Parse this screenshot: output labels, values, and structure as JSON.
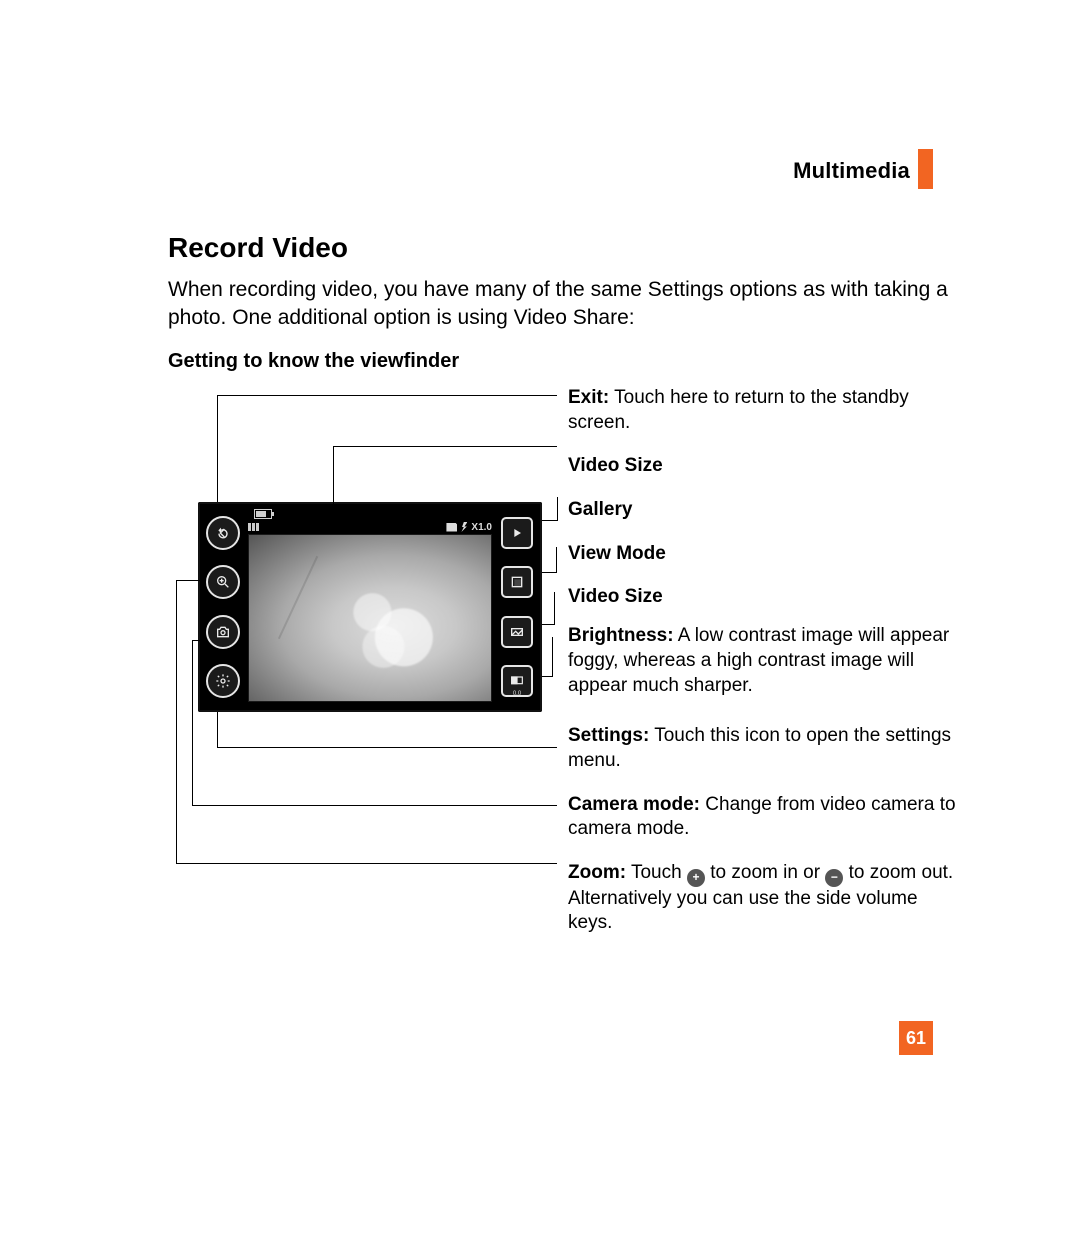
{
  "header": {
    "section": "Multimedia"
  },
  "title": "Record Video",
  "intro": "When recording video, you have many of the same Settings options as with taking a photo. One additional option is using Video Share:",
  "subtitle": "Getting to know the viewfinder",
  "viewfinder": {
    "zoom_label": "X1.0",
    "brightness_value": "0.0"
  },
  "callouts": {
    "exit": {
      "label": "Exit:",
      "text": " Touch here to return to the standby screen."
    },
    "video_size_top": "Video Size",
    "gallery": "Gallery",
    "view_mode": "View Mode",
    "video_size_side": "Video Size",
    "brightness": {
      "label": "Brightness:",
      "text": " A low contrast image will appear foggy, whereas a high contrast image will appear much sharper."
    },
    "settings": {
      "label": "Settings:",
      "text": " Touch this icon to open the settings menu."
    },
    "camera_mode": {
      "label": "Camera mode:",
      "text": " Change from video camera to camera mode."
    },
    "zoom": {
      "label": "Zoom:",
      "pre": " Touch ",
      "mid": " to zoom in or ",
      "post": " to zoom out. Alternatively you can use the side volume keys."
    }
  },
  "page_number": "61"
}
